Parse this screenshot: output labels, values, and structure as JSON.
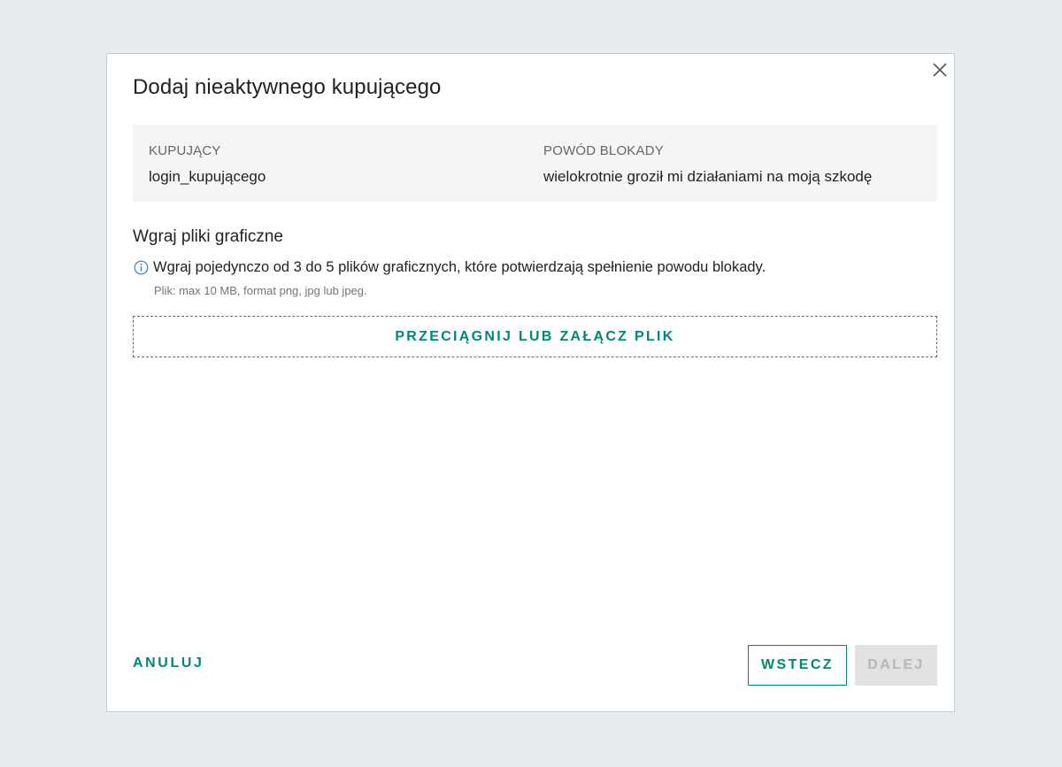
{
  "modal": {
    "title": "Dodaj nieaktywnego kupującego",
    "close_icon": "close-icon"
  },
  "info": {
    "buyer_label": "KUPUJĄCY",
    "buyer_value": "login_kupującego",
    "reason_label": "POWÓD BLOKADY",
    "reason_value": "wielokrotnie groził mi działaniami na moją szkodę"
  },
  "upload": {
    "title": "Wgraj pliki graficzne",
    "info_icon": "info-icon",
    "hint": "Wgraj pojedynczo od 3 do 5 plików graficznych, które potwierdzają spełnienie powodu blokady.",
    "subhint": "Plik: max 10 MB, format png, jpg lub jpeg.",
    "dropzone_label": "PRZECIĄGNIJ LUB ZAŁĄCZ PLIK"
  },
  "footer": {
    "cancel_label": "ANULUJ",
    "back_label": "WSTECZ",
    "next_label": "DALEJ",
    "next_disabled": true
  },
  "colors": {
    "accent": "#00887a",
    "page_background": "#e9ecef",
    "info_background": "#f4f5f6",
    "info_icon": "#2f84c4",
    "disabled_background": "#e2e2e2",
    "disabled_text": "#b7b7b7"
  }
}
